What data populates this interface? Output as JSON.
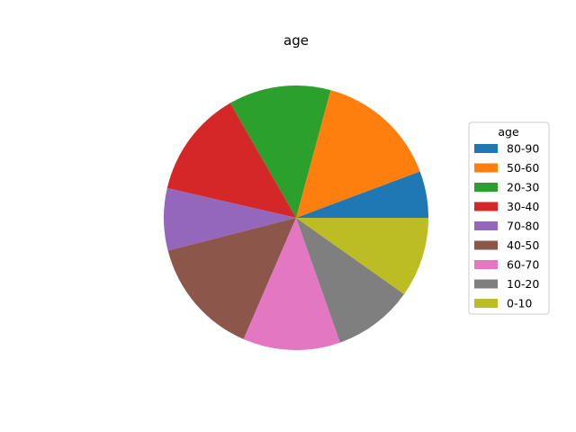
{
  "chart_data": {
    "type": "pie",
    "title": "age",
    "legend_title": "age",
    "legend_placement": "center-right",
    "categories": [
      "80-90",
      "50-60",
      "20-30",
      "30-40",
      "70-80",
      "40-50",
      "60-70",
      "10-20",
      "0-10"
    ],
    "values": [
      5.7,
      15.1,
      12.5,
      13.1,
      7.6,
      14.5,
      11.9,
      9.8,
      9.8
    ],
    "colors": [
      "#1f77b4",
      "#ff7f0e",
      "#2ca02c",
      "#d62728",
      "#9467bd",
      "#8c564b",
      "#e377c2",
      "#7f7f7f",
      "#bcbd22"
    ],
    "start_angle_deg": 0,
    "direction": "counterclockwise"
  }
}
